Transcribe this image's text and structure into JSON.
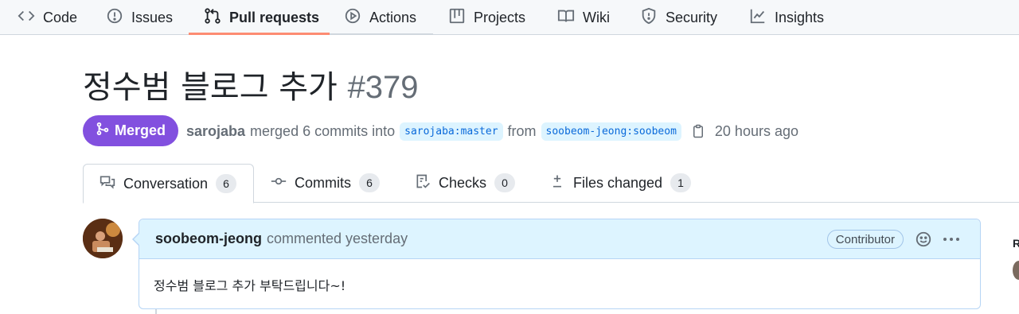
{
  "nav": {
    "items": [
      {
        "label": "Code",
        "icon": "code-icon"
      },
      {
        "label": "Issues",
        "icon": "issue-icon"
      },
      {
        "label": "Pull requests",
        "icon": "pull-request-icon",
        "active": true
      },
      {
        "label": "Actions",
        "icon": "play-icon"
      },
      {
        "label": "Projects",
        "icon": "table-icon"
      },
      {
        "label": "Wiki",
        "icon": "book-icon"
      },
      {
        "label": "Security",
        "icon": "shield-icon"
      },
      {
        "label": "Insights",
        "icon": "graph-icon"
      }
    ]
  },
  "pr": {
    "title": "정수범 블로그 추가",
    "number": "#379",
    "state": "Merged",
    "merger": "sarojaba",
    "merged_text": "merged 6 commits into",
    "base_branch": "sarojaba:master",
    "from_text": "from",
    "head_branch": "soobeom-jeong:soobeom",
    "time": "20 hours ago"
  },
  "tabs": [
    {
      "label": "Conversation",
      "count": "6",
      "icon": "comment-discussion-icon",
      "active": true
    },
    {
      "label": "Commits",
      "count": "6",
      "icon": "commit-icon"
    },
    {
      "label": "Checks",
      "count": "0",
      "icon": "checklist-icon"
    },
    {
      "label": "Files changed",
      "count": "1",
      "icon": "diff-icon"
    }
  ],
  "comment": {
    "author": "soobeom-jeong",
    "action": "commented yesterday",
    "role": "Contributor",
    "body": "정수범 블로그 추가 부탁드립니다~!"
  },
  "sidebar": {
    "label": "R"
  },
  "colors": {
    "merged": "#8250df",
    "accent_underline": "#fd8c73",
    "branch_bg": "#ddf4ff",
    "branch_text": "#0969da"
  }
}
